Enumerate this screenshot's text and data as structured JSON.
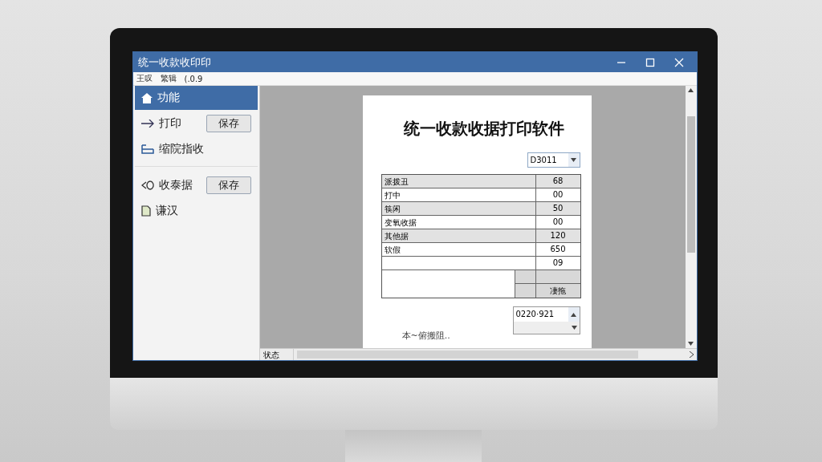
{
  "window": {
    "title": "统一收款收印印"
  },
  "menu": [
    "王叹",
    "繁辑",
    "(.0.9"
  ],
  "sidebar": {
    "items": [
      {
        "kind": "nav",
        "label": "功能",
        "selected": true
      },
      {
        "kind": "action",
        "label": "打印",
        "button": "保存",
        "selected": false
      },
      {
        "kind": "nav",
        "label": "缩院指收",
        "selected": false
      },
      {
        "kind": "divider"
      },
      {
        "kind": "action",
        "label": "收泰据",
        "button": "保存",
        "selected": false
      },
      {
        "kind": "nav",
        "label": "谦汉",
        "selected": false
      }
    ]
  },
  "document": {
    "title": "统一收款收据打印软件",
    "code_select": "D3011",
    "rows": [
      {
        "label": "派拨丑",
        "value": "68",
        "shaded": true
      },
      {
        "label": "打中",
        "value": "00",
        "shaded": false
      },
      {
        "label": "筷闲",
        "value": "50",
        "shaded": true
      },
      {
        "label": "变氧收据",
        "value": "00",
        "shaded": false
      },
      {
        "label": "其他据",
        "value": "120",
        "shaded": true
      },
      {
        "label": "软假",
        "value": "650",
        "shaded": false
      },
      {
        "label": "",
        "value": "09",
        "shaded": false
      }
    ],
    "total_label": "凄拖",
    "date_select": "0220·921",
    "note": "本~俯搬阻.."
  },
  "status_bar": {
    "label": "状态"
  }
}
